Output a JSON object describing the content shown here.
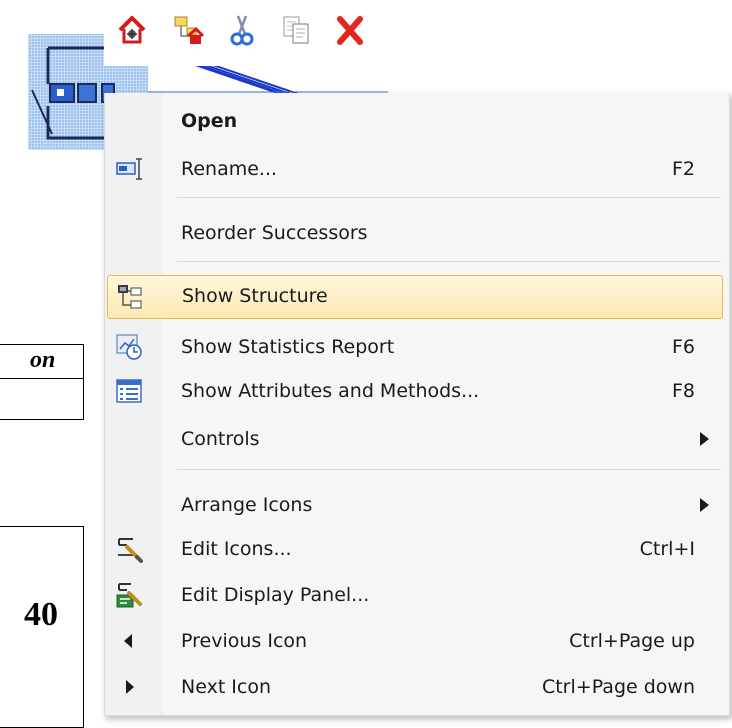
{
  "background": {
    "fragment_text_top": "on",
    "fragment_text_bottom": "40"
  },
  "toolbar": {
    "buttons": [
      {
        "name": "home-icon"
      },
      {
        "name": "tree-icon"
      },
      {
        "name": "cut-icon"
      },
      {
        "name": "copy-icon"
      },
      {
        "name": "delete-icon"
      }
    ]
  },
  "menu": {
    "items": [
      {
        "label": "Open",
        "shortcut": "",
        "icon": "none",
        "bold": true
      },
      {
        "label": "Rename...",
        "shortcut": "F2",
        "icon": "rename-icon"
      },
      {
        "label": "Reorder Successors",
        "shortcut": "",
        "icon": "none"
      },
      {
        "label": "Show Structure",
        "shortcut": "",
        "icon": "structure-icon",
        "highlighted": true
      },
      {
        "label": "Show Statistics Report",
        "shortcut": "F6",
        "icon": "statistics-report-icon"
      },
      {
        "label": "Show Attributes and Methods...",
        "shortcut": "F8",
        "icon": "attributes-list-icon"
      },
      {
        "label": "Controls",
        "shortcut": "",
        "icon": "none",
        "submenu": true
      },
      {
        "label": "Arrange Icons",
        "shortcut": "",
        "icon": "none",
        "submenu": true
      },
      {
        "label": "Edit Icons...",
        "shortcut": "Ctrl+I",
        "icon": "edit-icons-icon"
      },
      {
        "label": "Edit Display Panel...",
        "shortcut": "",
        "icon": "edit-display-panel-icon"
      },
      {
        "label": "Previous Icon",
        "shortcut": "Ctrl+Page up",
        "icon": "triangle-left-icon"
      },
      {
        "label": "Next Icon",
        "shortcut": "Ctrl+Page down",
        "icon": "triangle-right-icon"
      }
    ]
  },
  "colors": {
    "highlight_border": "#e8b94a",
    "highlight_fill": "#fde9b4",
    "menu_background": "#f5f6f7",
    "selection_blue": "#9fc3ef"
  }
}
